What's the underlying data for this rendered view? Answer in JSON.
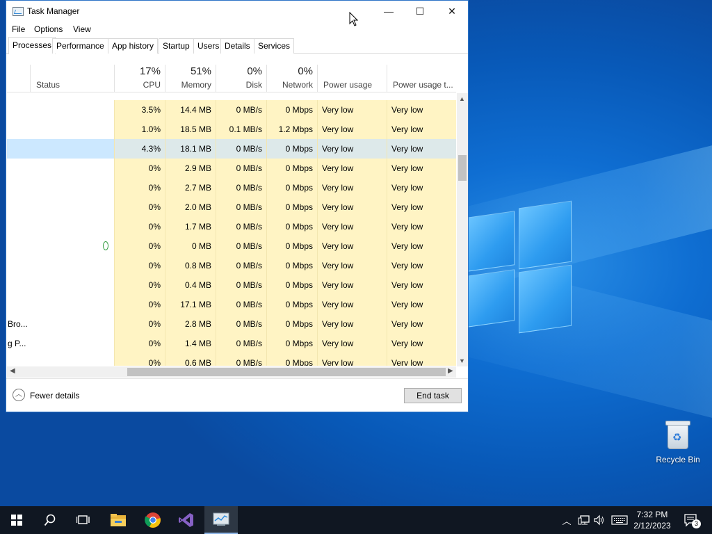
{
  "window": {
    "title": "Task Manager",
    "minimize": "—",
    "maximize": "☐",
    "close": "✕"
  },
  "menu": [
    "File",
    "Options",
    "View"
  ],
  "tabs": [
    "Processes",
    "Performance",
    "App history",
    "Startup",
    "Users",
    "Details",
    "Services"
  ],
  "active_tab": "Processes",
  "columns": {
    "status": "Status",
    "cpu": {
      "pct": "17%",
      "name": "CPU"
    },
    "memory": {
      "pct": "51%",
      "name": "Memory"
    },
    "disk": {
      "pct": "0%",
      "name": "Disk"
    },
    "network": {
      "pct": "0%",
      "name": "Network"
    },
    "power": "Power usage",
    "power_trend": "Power usage t..."
  },
  "rows": [
    {
      "name": "",
      "cpu": "3.5%",
      "memory": "14.4 MB",
      "disk": "0 MB/s",
      "network": "0 Mbps",
      "power": "Very low",
      "power_trend": "Very low"
    },
    {
      "name": "",
      "cpu": "1.0%",
      "memory": "18.5 MB",
      "disk": "0.1 MB/s",
      "network": "1.2 Mbps",
      "power": "Very low",
      "power_trend": "Very low"
    },
    {
      "name": "",
      "cpu": "4.3%",
      "memory": "18.1 MB",
      "disk": "0 MB/s",
      "network": "0 Mbps",
      "power": "Very low",
      "power_trend": "Very low",
      "selected": true
    },
    {
      "name": "",
      "cpu": "0%",
      "memory": "2.9 MB",
      "disk": "0 MB/s",
      "network": "0 Mbps",
      "power": "Very low",
      "power_trend": "Very low"
    },
    {
      "name": "",
      "cpu": "0%",
      "memory": "2.7 MB",
      "disk": "0 MB/s",
      "network": "0 Mbps",
      "power": "Very low",
      "power_trend": "Very low"
    },
    {
      "name": "",
      "cpu": "0%",
      "memory": "2.0 MB",
      "disk": "0 MB/s",
      "network": "0 Mbps",
      "power": "Very low",
      "power_trend": "Very low"
    },
    {
      "name": "",
      "cpu": "0%",
      "memory": "1.7 MB",
      "disk": "0 MB/s",
      "network": "0 Mbps",
      "power": "Very low",
      "power_trend": "Very low"
    },
    {
      "name": "",
      "cpu": "0%",
      "memory": "0 MB",
      "disk": "0 MB/s",
      "network": "0 Mbps",
      "power": "Very low",
      "power_trend": "Very low",
      "suspended_icon": "leaf-icon"
    },
    {
      "name": "",
      "cpu": "0%",
      "memory": "0.8 MB",
      "disk": "0 MB/s",
      "network": "0 Mbps",
      "power": "Very low",
      "power_trend": "Very low"
    },
    {
      "name": "",
      "cpu": "0%",
      "memory": "0.4 MB",
      "disk": "0 MB/s",
      "network": "0 Mbps",
      "power": "Very low",
      "power_trend": "Very low"
    },
    {
      "name": "",
      "cpu": "0%",
      "memory": "17.1 MB",
      "disk": "0 MB/s",
      "network": "0 Mbps",
      "power": "Very low",
      "power_trend": "Very low"
    },
    {
      "name": "Bro...",
      "cpu": "0%",
      "memory": "2.8 MB",
      "disk": "0 MB/s",
      "network": "0 Mbps",
      "power": "Very low",
      "power_trend": "Very low"
    },
    {
      "name": "g P...",
      "cpu": "0%",
      "memory": "1.4 MB",
      "disk": "0 MB/s",
      "network": "0 Mbps",
      "power": "Very low",
      "power_trend": "Very low"
    },
    {
      "name": "",
      "cpu": "0%",
      "memory": "0.6 MB",
      "disk": "0 MB/s",
      "network": "0 Mbps",
      "power": "Very low",
      "power_trend": "Very low"
    }
  ],
  "footer": {
    "fewer_details": "Fewer details",
    "end_task": "End task"
  },
  "desktop": {
    "recycle_bin": "Recycle Bin"
  },
  "taskbar": {
    "apps": [
      "start-icon",
      "search-icon",
      "task-view-icon",
      "file-explorer-icon",
      "chrome-icon",
      "visual-studio-icon",
      "task-manager-icon"
    ],
    "time": "7:32 PM",
    "date": "2/12/2023",
    "notification_count": "3"
  }
}
